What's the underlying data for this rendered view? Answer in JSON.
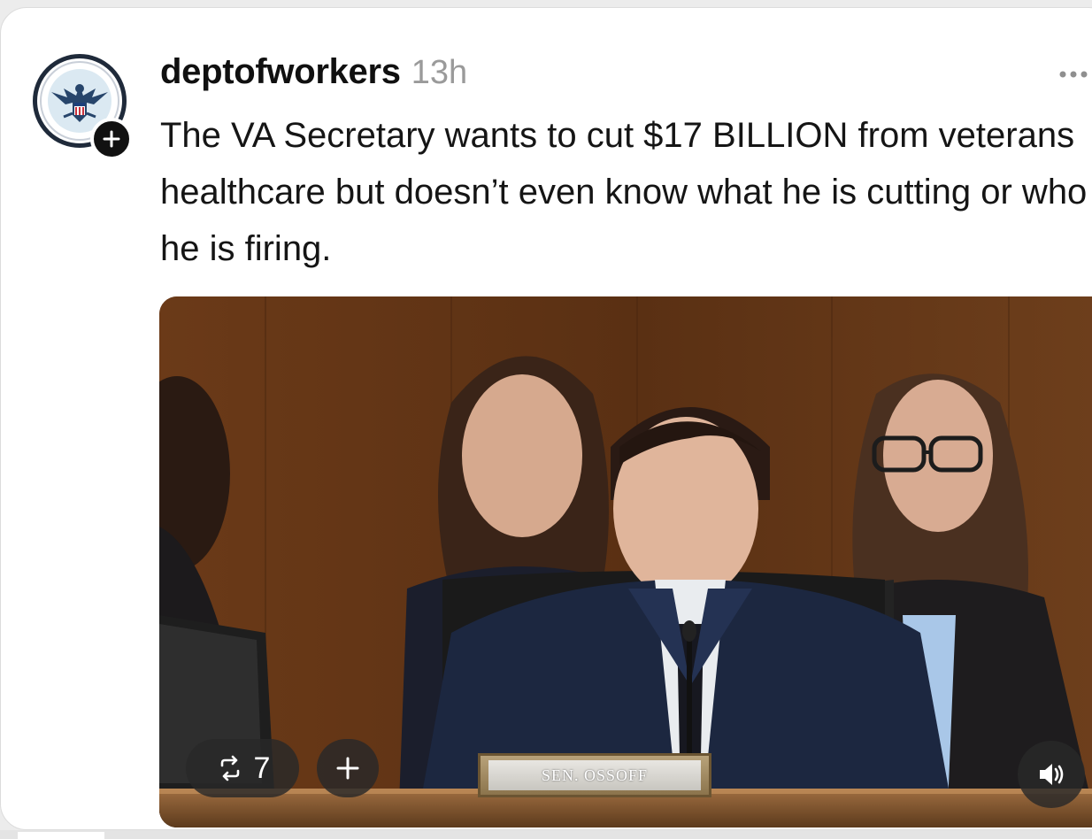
{
  "post": {
    "username": "deptofworkers",
    "timestamp": "13h",
    "text": "The VA Secretary wants to cut $17 BILLION from veterans healthcare but doesn’t even know what he is cutting or who he is firing."
  },
  "video": {
    "nameplate": "SEN. OSSOFF",
    "repost_count": "7"
  },
  "icons": {
    "avatar": "department-seal-eagle-icon",
    "follow": "plus-icon",
    "more": "ellipsis-icon",
    "repost": "repost-icon",
    "add": "plus-icon",
    "volume": "speaker-icon"
  }
}
